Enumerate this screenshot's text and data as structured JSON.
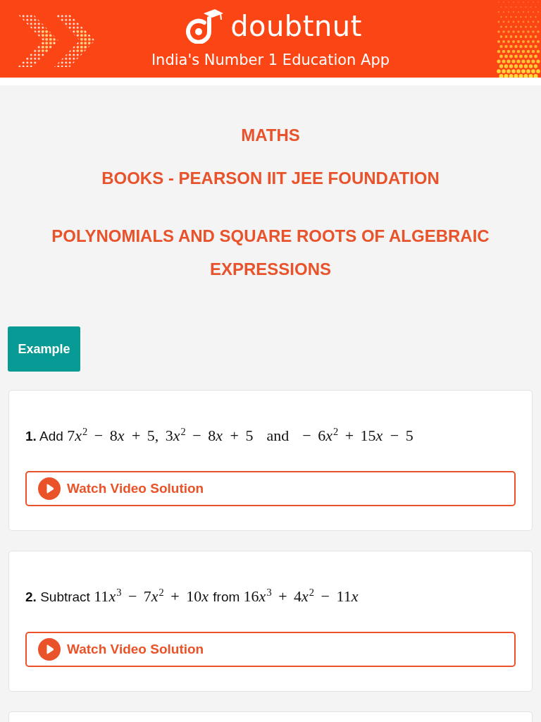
{
  "header": {
    "logo_text": "doubtnut",
    "tagline": "India's Number 1 Education App"
  },
  "headings": {
    "subject": "MATHS",
    "book": "BOOKS - PEARSON IIT JEE FOUNDATION",
    "chapter": "POLYNOMIALS AND SQUARE ROOTS OF ALGEBRAIC EXPRESSIONS"
  },
  "section_label": "Example",
  "questions": [
    {
      "number": "1.",
      "segments": [
        {
          "kind": "text",
          "text": "Add "
        },
        {
          "kind": "math",
          "text": "7"
        },
        {
          "kind": "var",
          "text": "x"
        },
        {
          "kind": "math",
          "text": "$^{2}$ − 8"
        },
        {
          "kind": "var",
          "text": "x"
        },
        {
          "kind": "math",
          "text": " + 5, 3"
        },
        {
          "kind": "var",
          "text": "x"
        },
        {
          "kind": "math",
          "text": "$^{2}$ − 8"
        },
        {
          "kind": "var",
          "text": "x"
        },
        {
          "kind": "math",
          "text": " + 5  and  − 6"
        },
        {
          "kind": "var",
          "text": "x"
        },
        {
          "kind": "math",
          "text": "$^{2}$ + 15"
        },
        {
          "kind": "var",
          "text": "x"
        },
        {
          "kind": "math",
          "text": " − 5"
        }
      ],
      "button": "Watch Video Solution"
    },
    {
      "number": "2.",
      "segments": [
        {
          "kind": "text",
          "text": "Subtract "
        },
        {
          "kind": "math",
          "text": "11"
        },
        {
          "kind": "var",
          "text": "x"
        },
        {
          "kind": "math",
          "text": "$^{3}$ − 7"
        },
        {
          "kind": "var",
          "text": "x"
        },
        {
          "kind": "math",
          "text": "$^{2}$ + 10"
        },
        {
          "kind": "var",
          "text": "x"
        },
        {
          "kind": "text",
          "text": " from "
        },
        {
          "kind": "math",
          "text": "16"
        },
        {
          "kind": "var",
          "text": "x"
        },
        {
          "kind": "math",
          "text": "$^{3}$ + 4"
        },
        {
          "kind": "var",
          "text": "x"
        },
        {
          "kind": "math",
          "text": "$^{2}$ − 11"
        },
        {
          "kind": "var",
          "text": "x"
        }
      ],
      "button": "Watch Video Solution"
    }
  ]
}
